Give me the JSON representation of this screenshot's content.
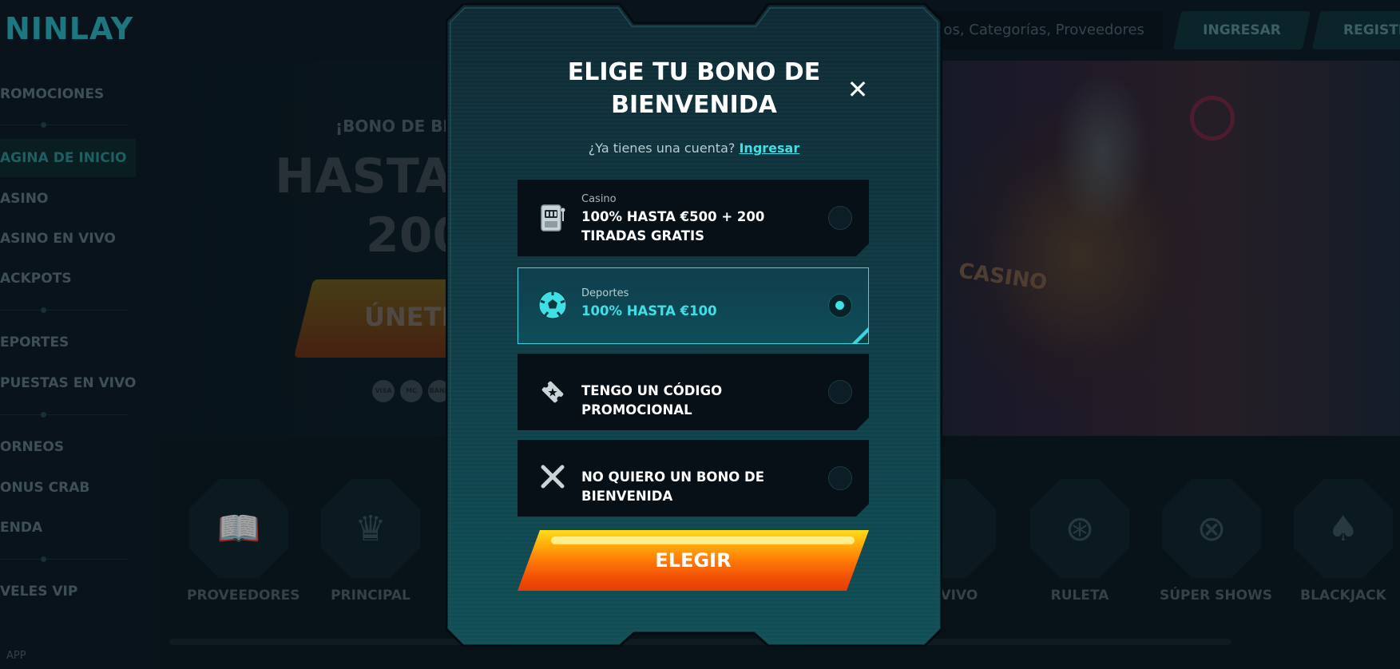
{
  "header": {
    "logo_text": "NINLAY",
    "search_placeholder": "gos, Categorías, Proveedores",
    "login_label": "INGRESAR",
    "register_label": "REGISTR"
  },
  "sidebar": {
    "items": [
      {
        "label": "ROMOCIONES"
      },
      {
        "label": "AGINA DE INICIO"
      },
      {
        "label": "ASINO"
      },
      {
        "label": "ASINO EN VIVO"
      },
      {
        "label": "ACKPOTS"
      },
      {
        "label": "EPORTES"
      },
      {
        "label": "PUESTAS EN VIVO"
      },
      {
        "label": "ORNEOS"
      },
      {
        "label": "ONUS CRAB"
      },
      {
        "label": "ENDA"
      },
      {
        "label": "VELES VIP"
      }
    ],
    "app_label": "APP"
  },
  "hero": {
    "subtitle": "¡BONO DE BIEN",
    "title_line1": "HASTA",
    "title_line2": "200",
    "join_label": "ÚNETE",
    "payment_icons": [
      "VISA",
      "MC",
      "BANK"
    ]
  },
  "categories": [
    {
      "label": "PROVEEDORES",
      "icon": "book-icon"
    },
    {
      "label": "PRINCIPAL",
      "icon": "crown-icon"
    },
    {
      "label": "EN VIVO",
      "icon": "live-icon"
    },
    {
      "label": "RULETA",
      "icon": "roulette-icon"
    },
    {
      "label": "SÚPER SHOWS",
      "icon": "wheel-icon"
    },
    {
      "label": "BLACKJACK",
      "icon": "cards-icon"
    }
  ],
  "modal": {
    "title": "ELIGE TU BONO DE BIENVENIDA",
    "login_prompt": "¿Ya tienes una cuenta?",
    "login_link": "Ingresar",
    "options": [
      {
        "category": "Casino",
        "text": "100% HASTA €500 + 200 TIRADAS GRATIS",
        "icon": "slot-machine-icon",
        "selected": false
      },
      {
        "category": "Deportes",
        "text": "100% HASTA €100",
        "icon": "soccer-ball-icon",
        "selected": true
      },
      {
        "category": "",
        "text": "TENGO UN CÓDIGO PROMOCIONAL",
        "icon": "promo-ticket-icon",
        "selected": false
      },
      {
        "category": "",
        "text": "NO QUIERO UN BONO DE BIENVENIDA",
        "icon": "cross-icon",
        "selected": false
      }
    ],
    "submit_label": "ELEGIR"
  },
  "colors": {
    "accent": "#3ee0e6",
    "button_top": "#ffdc1c",
    "button_bottom": "#e63c05",
    "modal_bg": "#0f3a44"
  }
}
